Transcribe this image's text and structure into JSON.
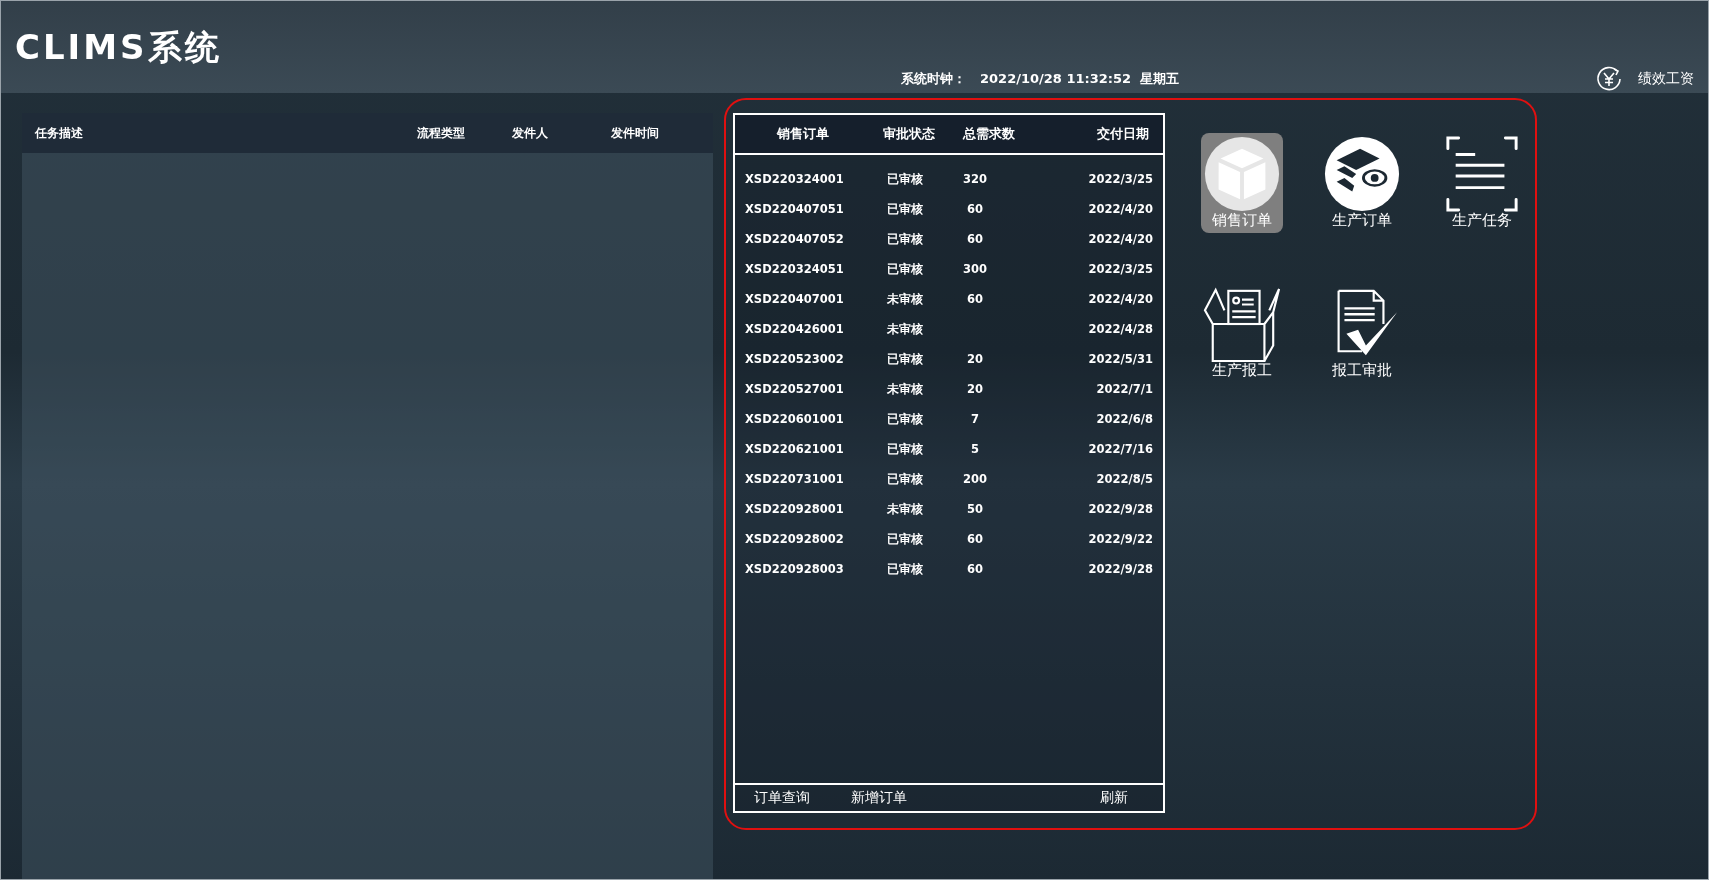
{
  "app_title": "CLIMS系统",
  "clock": {
    "label": "系统时钟：",
    "value": "2022/10/28 11:32:52  星期五"
  },
  "top_link": {
    "label": "绩效工资"
  },
  "task_table": {
    "columns": [
      "任务描述",
      "流程类型",
      "发件人",
      "发件时间"
    ]
  },
  "order_table": {
    "columns": [
      "销售订单",
      "审批状态",
      "总需求数",
      "交付日期"
    ],
    "rows": [
      {
        "order": "XSD220324001",
        "status": "已审核",
        "qty": "320",
        "date": "2022/3/25"
      },
      {
        "order": "XSD220407051",
        "status": "已审核",
        "qty": "60",
        "date": "2022/4/20"
      },
      {
        "order": "XSD220407052",
        "status": "已审核",
        "qty": "60",
        "date": "2022/4/20"
      },
      {
        "order": "XSD220324051",
        "status": "已审核",
        "qty": "300",
        "date": "2022/3/25"
      },
      {
        "order": "XSD220407001",
        "status": "未审核",
        "qty": "60",
        "date": "2022/4/20"
      },
      {
        "order": "XSD220426001",
        "status": "未审核",
        "date": "2022/4/28"
      },
      {
        "order": "XSD220523002",
        "status": "已审核",
        "qty": "20",
        "date": "2022/5/31"
      },
      {
        "order": "XSD220527001",
        "status": "未审核",
        "qty": "20",
        "date": "2022/7/1"
      },
      {
        "order": "XSD220601001",
        "status": "已审核",
        "qty": "7",
        "date": "2022/6/8"
      },
      {
        "order": "XSD220621001",
        "status": "已审核",
        "qty": "5",
        "date": "2022/7/16"
      },
      {
        "order": "XSD220731001",
        "status": "已审核",
        "qty": "200",
        "date": "2022/8/5"
      },
      {
        "order": "XSD220928001",
        "status": "未审核",
        "qty": "50",
        "date": "2022/9/28"
      },
      {
        "order": "XSD220928002",
        "status": "已审核",
        "qty": "60",
        "date": "2022/9/22"
      },
      {
        "order": "XSD220928003",
        "status": "已审核",
        "qty": "60",
        "date": "2022/9/28"
      }
    ],
    "footer_buttons": [
      "订单查询",
      "新增订单",
      "刷新"
    ]
  },
  "apps": [
    {
      "label": "销售订单",
      "selected": true
    },
    {
      "label": "生产订单",
      "selected": false
    },
    {
      "label": "生产任务",
      "selected": false
    },
    {
      "label": "生产报工",
      "selected": false
    },
    {
      "label": "报工审批",
      "selected": false
    }
  ]
}
